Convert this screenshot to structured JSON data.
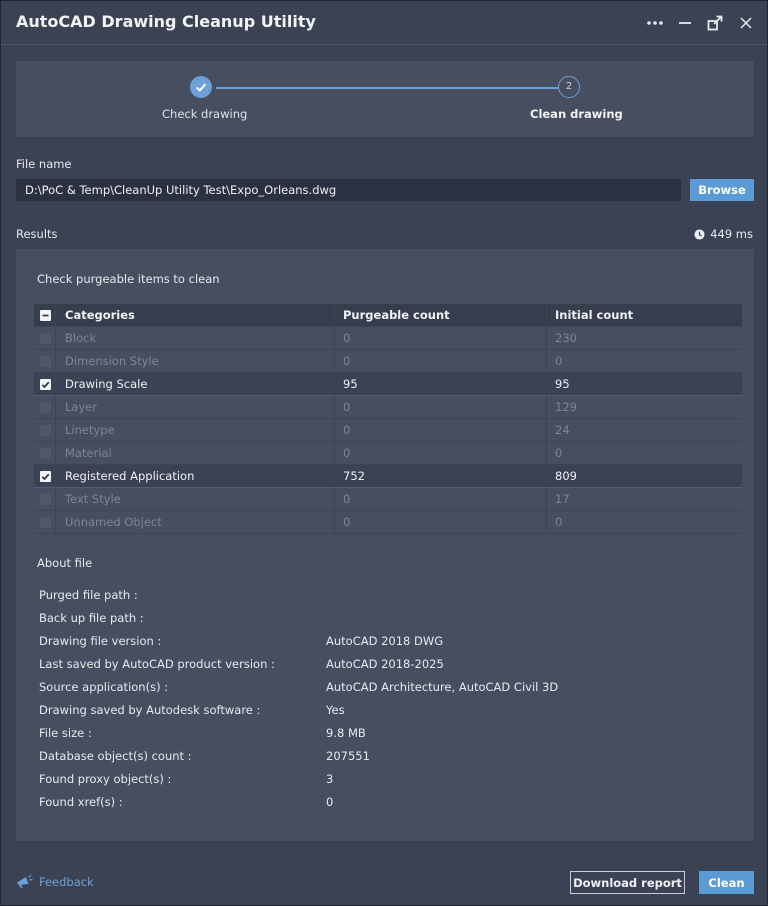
{
  "window": {
    "title": "AutoCAD Drawing Cleanup Utility"
  },
  "stepper": {
    "steps": [
      {
        "label": "Check drawing",
        "state": "complete"
      },
      {
        "label": "Clean drawing",
        "number": "2",
        "state": "active"
      }
    ]
  },
  "file": {
    "label": "File name",
    "path": "D:\\PoC & Temp\\CleanUp Utility Test\\Expo_Orleans.dwg",
    "browse_label": "Browse"
  },
  "results": {
    "label": "Results",
    "elapsed": "449 ms",
    "instruction": "Check purgeable items to clean",
    "columns": [
      "Categories",
      "Purgeable count",
      "Initial count"
    ],
    "rows": [
      {
        "category": "Block",
        "purgeable": "0",
        "initial": "230",
        "checked": false
      },
      {
        "category": "Dimension Style",
        "purgeable": "0",
        "initial": "0",
        "checked": false
      },
      {
        "category": "Drawing Scale",
        "purgeable": "95",
        "initial": "95",
        "checked": true
      },
      {
        "category": "Layer",
        "purgeable": "0",
        "initial": "129",
        "checked": false
      },
      {
        "category": "Linetype",
        "purgeable": "0",
        "initial": "24",
        "checked": false
      },
      {
        "category": "Material",
        "purgeable": "0",
        "initial": "0",
        "checked": false
      },
      {
        "category": "Registered Application",
        "purgeable": "752",
        "initial": "809",
        "checked": true
      },
      {
        "category": "Text Style",
        "purgeable": "0",
        "initial": "17",
        "checked": false
      },
      {
        "category": "Unnamed Object",
        "purgeable": "0",
        "initial": "0",
        "checked": false
      }
    ]
  },
  "about": {
    "title": "About file",
    "items": [
      {
        "label": "Purged file path :",
        "value": ""
      },
      {
        "label": "Back up file path :",
        "value": ""
      },
      {
        "label": "Drawing file version :",
        "value": "AutoCAD 2018 DWG"
      },
      {
        "label": "Last saved by AutoCAD product version :",
        "value": "AutoCAD 2018-2025"
      },
      {
        "label": "Source application(s) :",
        "value": "AutoCAD Architecture, AutoCAD Civil 3D"
      },
      {
        "label": "Drawing saved by Autodesk software :",
        "value": "Yes"
      },
      {
        "label": "File size :",
        "value": "9.8 MB"
      },
      {
        "label": "Database object(s) count :",
        "value": "207551"
      },
      {
        "label": "Found proxy object(s) :",
        "value": "3"
      },
      {
        "label": "Found xref(s) :",
        "value": "0"
      }
    ]
  },
  "footer": {
    "feedback_label": "Feedback",
    "download_label": "Download report",
    "clean_label": "Clean"
  },
  "icons": {
    "more": "more-horizontal-icon",
    "minimize": "minimize-icon",
    "popout": "popout-icon",
    "close": "close-icon",
    "clock": "clock-icon",
    "feedback": "megaphone-icon"
  },
  "colors": {
    "accent": "#5b9bd5",
    "background": "#3b4253",
    "panel": "#464e60"
  }
}
